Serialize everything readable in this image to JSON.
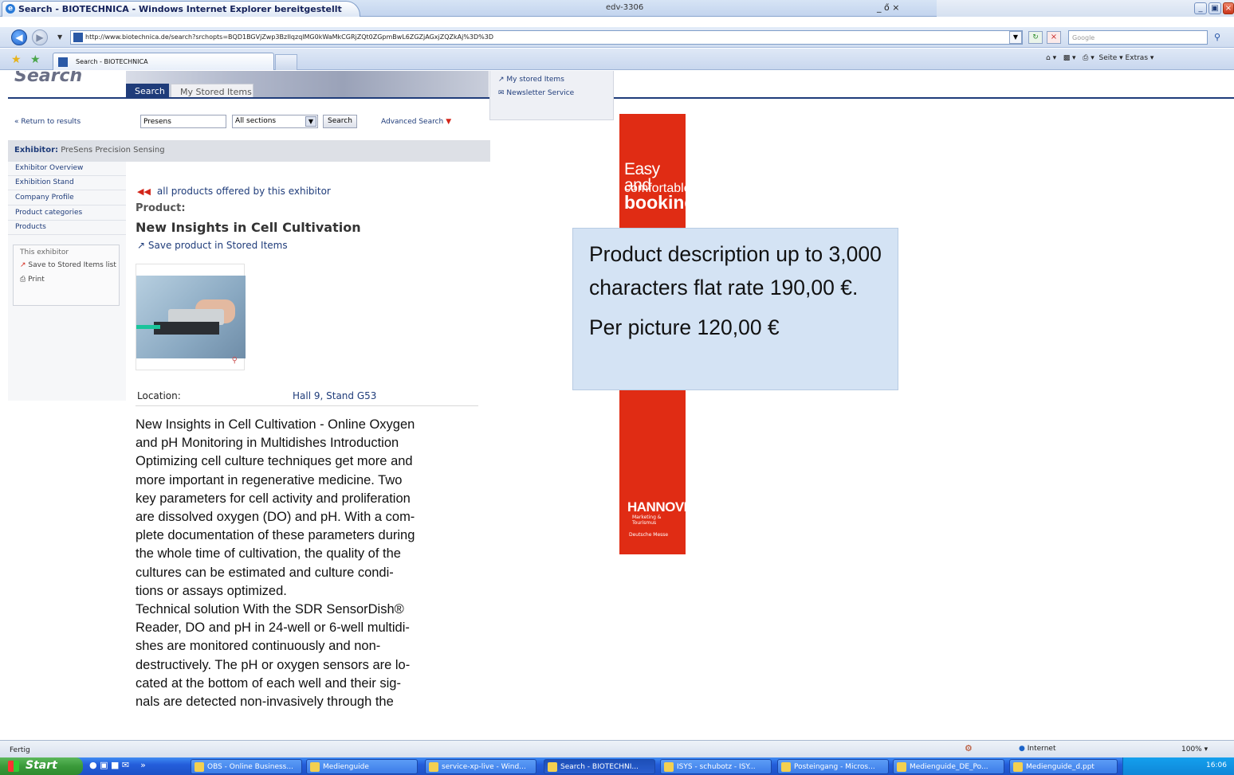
{
  "window": {
    "title": "Search - BIOTECHNICA - Windows Internet Explorer bereitgestellt",
    "machine": "edv-3306",
    "controls": "_ ő ×"
  },
  "addressbar": {
    "url": "http://www.biotechnica.de/search?srchopts=BQD1BGVjZwp3BzIIqzqlMG0kWaMkCGRjZQt0ZGpmBwL6ZGZjAGxjZQZkAj%3D%3D",
    "search_placeholder": "Google"
  },
  "tabs": {
    "active_label": "Search - BIOTECHNICA",
    "tools_text": "Seite ▾  Extras ▾"
  },
  "page": {
    "header_title": "Search",
    "tab_search": "Search",
    "tab_stored": "My Stored Items",
    "dropdown": [
      "My stored Items",
      "Newsletter Service"
    ],
    "return_link": "Return to results",
    "search_value": "Presens",
    "section_value": "All sections",
    "search_button": "Search",
    "advanced_search": "Advanced Search",
    "exhibitor_label": "Exhibitor:",
    "exhibitor_name": "PreSens Precision Sensing",
    "side_nav": [
      "Exhibitor Overview",
      "Exhibition Stand",
      "Company Profile",
      "Product categories",
      "Products"
    ],
    "this_exhibitor": "This exhibitor",
    "save_stored": "Save to Stored Items list",
    "print": "Print",
    "all_products": "all products offered by this exhibitor",
    "product_label": "Product:",
    "product_title": "New Insights in Cell Cultivation",
    "save_product": "Save product in Stored Items",
    "location_label": "Location:",
    "location_value": "Hall 9, Stand G53",
    "description": "New Insights in Cell Cultivation - Online Oxygen\nand pH Monitoring in Multidishes Introduction\nOptimizing cell culture techniques get more and\nmore important in regenerative medicine. Two\nkey parameters for cell activity and proliferation\nare dissolved oxygen (DO) and pH. With a com-\nplete documentation of these parameters during\nthe whole time of cultivation, the quality of the\ncultures can be estimated and culture condi-\ntions or assays optimized.\nTechnical solution With the SDR SensorDish®\nReader, DO and pH in 24-well or 6-well multidi-\nshes are monitored continuously and non-\ndestructively. The pH or oxygen sensors are lo-\ncated at the bottom of each well and their sig-\nnals are detected non-invasively through the"
  },
  "banner": {
    "line1": "Easy and",
    "line2": "comfortable",
    "line3": "booking",
    "brand": "HANNOVER",
    "brand_sub": "Marketing & Tourismus",
    "partner": "Deutsche Messe"
  },
  "callout": {
    "text1": "Product description up to 3,000 characters flat rate 190,00 €.",
    "text2": "Per picture 120,00 €"
  },
  "statusbar": {
    "status": "Fertig",
    "zone": "Internet",
    "zoom": "100%"
  },
  "taskbar": {
    "start": "Start",
    "items": [
      "OBS - Online Business...",
      "Medienguide",
      "service-xp-live - Wind...",
      "Search - BIOTECHNI...",
      "ISYS - schubotz - ISY...",
      "Posteingang - Micros...",
      "Medienguide_DE_Po...",
      "Medienguide_d.ppt"
    ],
    "clock": "16:06"
  }
}
